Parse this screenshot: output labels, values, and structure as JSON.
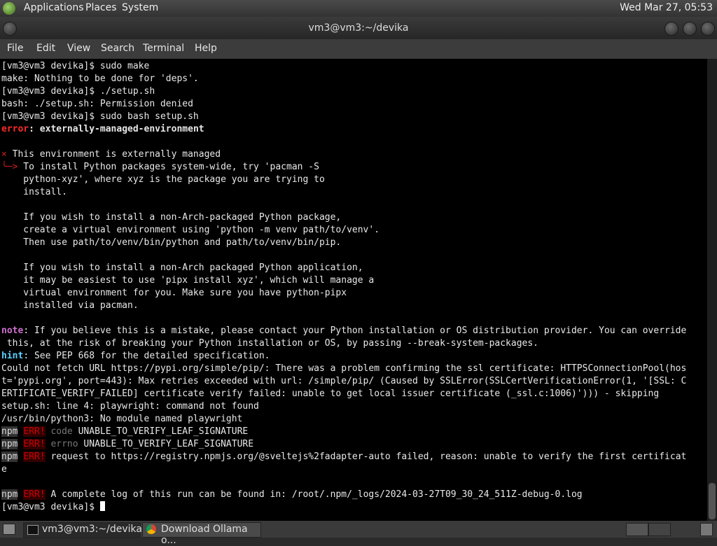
{
  "top_panel": {
    "menus": [
      "Applications",
      "Places",
      "System"
    ],
    "clock": "Wed Mar 27, 05:53"
  },
  "window": {
    "title": "vm3@vm3:~/devika",
    "menu": [
      "File",
      "Edit",
      "View",
      "Search",
      "Terminal",
      "Help"
    ]
  },
  "terminal": {
    "lines": [
      "[vm3@vm3 devika]$ sudo make",
      "make: Nothing to be done for 'deps'.",
      "[vm3@vm3 devika]$ ./setup.sh",
      "bash: ./setup.sh: Permission denied",
      "[vm3@vm3 devika]$ sudo bash setup.sh",
      "",
      "",
      "",
      "    To install Python packages system-wide, try 'pacman -S",
      "    python-xyz', where xyz is the package you are trying to",
      "    install.",
      "",
      "    If you wish to install a non-Arch-packaged Python package,",
      "    create a virtual environment using 'python -m venv path/to/venv'.",
      "    Then use path/to/venv/bin/python and path/to/venv/bin/pip.",
      "",
      "    If you wish to install a non-Arch packaged Python application,",
      "    it may be easiest to use 'pipx install xyz', which will manage a",
      "    virtual environment for you. Make sure you have python-pipx",
      "    installed via pacman.",
      "",
      "",
      " this, at the risk of breaking your Python installation or OS, by passing --break-system-packages.",
      "",
      "Could not fetch URL https://pypi.org/simple/pip/: There was a problem confirming the ssl certificate: HTTPSConnectionPool(hos",
      "t='pypi.org', port=443): Max retries exceeded with url: /simple/pip/ (Caused by SSLError(SSLCertVerificationError(1, '[SSL: C",
      "ERTIFICATE_VERIFY_FAILED] certificate verify failed: unable to get local issuer certificate (_ssl.c:1006)'))) - skipping",
      "setup.sh: line 4: playwright: command not found",
      "/usr/bin/python3: No module named playwright"
    ],
    "error_label": "error",
    "error_text": ": externally-managed-environment",
    "x_mark": "×",
    "env_managed": " This environment is externally managed",
    "arrow": "╰─>",
    "note_label": "note",
    "note_text": ": If you believe this is a mistake, please contact your Python installation or OS distribution provider. You can override",
    "hint_label": "hint",
    "hint_text": ": See PEP 668 for the detailed specification.",
    "npm": [
      {
        "tag": "npm",
        "level": "ERR!",
        "key": "code",
        "msg": " UNABLE_TO_VERIFY_LEAF_SIGNATURE"
      },
      {
        "tag": "npm",
        "level": "ERR!",
        "key": "errno",
        "msg": " UNABLE_TO_VERIFY_LEAF_SIGNATURE"
      },
      {
        "tag": "npm",
        "level": "ERR!",
        "key": "",
        "msg": " request to https://registry.npmjs.org/@sveltejs%2fadapter-auto failed, reason: unable to verify the first certificat"
      }
    ],
    "wrap_e": "e",
    "npm_log": {
      "tag": "npm",
      "level": "ERR!",
      "msg": " A complete log of this run can be found in: /root/.npm/_logs/2024-03-27T09_30_24_511Z-debug-0.log"
    },
    "prompt": "[vm3@vm3 devika]$ "
  },
  "taskbar": {
    "items": [
      {
        "label": "vm3@vm3:~/devika",
        "icon": "terminal-icon"
      },
      {
        "label": "Download Ollama o...",
        "icon": "chrome-icon"
      }
    ]
  }
}
